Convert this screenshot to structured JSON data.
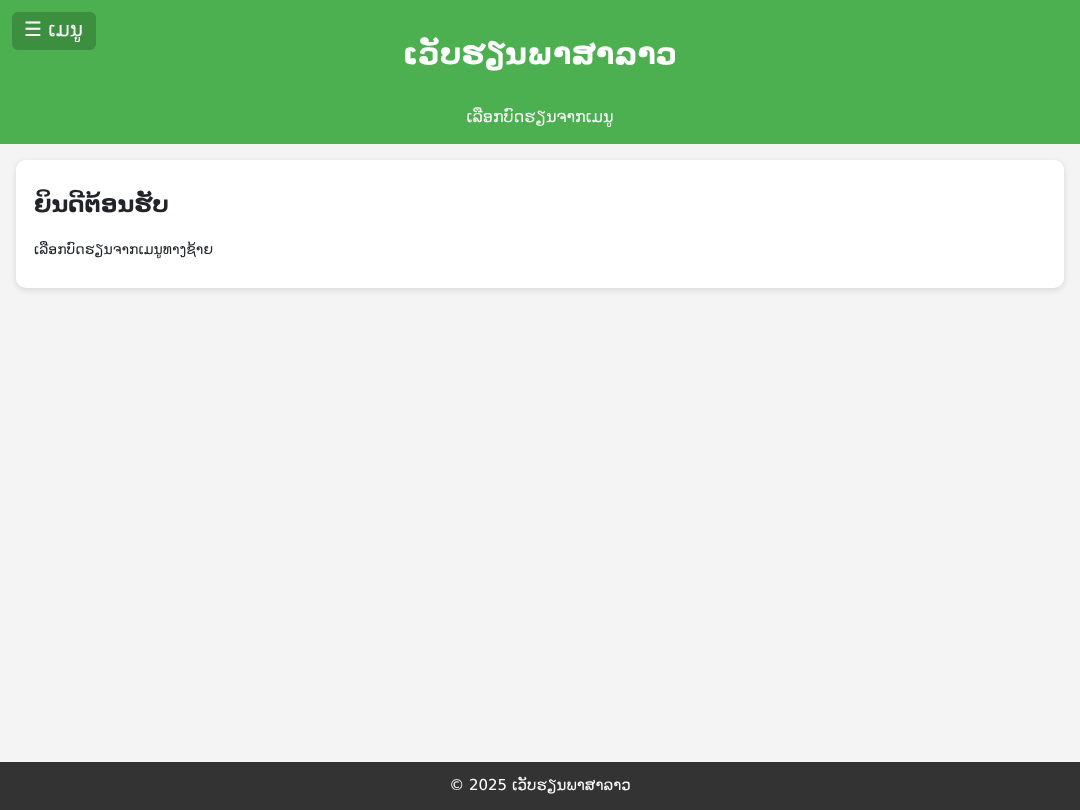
{
  "header": {
    "menu_button": {
      "icon": "☰",
      "label": "ເມນູ"
    },
    "title": "ເວັບຮຽນພາສາລາວ",
    "subtitle": "ເລືອກບົດຮຽນຈາກເມນູ"
  },
  "welcome_card": {
    "heading": "ຍິນດີຕ້ອນຮັບ",
    "text": "ເລືອກບົດຮຽນຈາກເມນູທາງຊ້າຍ"
  },
  "footer": {
    "text": "© 2025 ເວັບຮຽນພາສາລາວ"
  }
}
